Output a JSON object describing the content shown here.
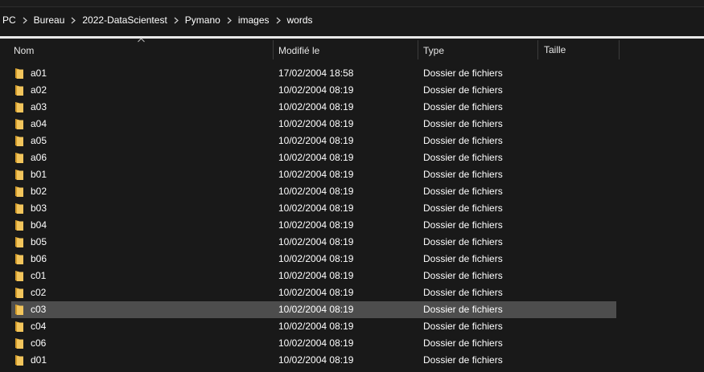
{
  "breadcrumb": [
    "PC",
    "Bureau",
    "2022-DataScientest",
    "Pymano",
    "images",
    "words"
  ],
  "columns": {
    "name": "Nom",
    "modified": "Modifié le",
    "type": "Type",
    "size": "Taille"
  },
  "rows": [
    {
      "name": "a01",
      "modified": "17/02/2004 18:58",
      "type": "Dossier de fichiers",
      "size": ""
    },
    {
      "name": "a02",
      "modified": "10/02/2004 08:19",
      "type": "Dossier de fichiers",
      "size": ""
    },
    {
      "name": "a03",
      "modified": "10/02/2004 08:19",
      "type": "Dossier de fichiers",
      "size": ""
    },
    {
      "name": "a04",
      "modified": "10/02/2004 08:19",
      "type": "Dossier de fichiers",
      "size": ""
    },
    {
      "name": "a05",
      "modified": "10/02/2004 08:19",
      "type": "Dossier de fichiers",
      "size": ""
    },
    {
      "name": "a06",
      "modified": "10/02/2004 08:19",
      "type": "Dossier de fichiers",
      "size": ""
    },
    {
      "name": "b01",
      "modified": "10/02/2004 08:19",
      "type": "Dossier de fichiers",
      "size": ""
    },
    {
      "name": "b02",
      "modified": "10/02/2004 08:19",
      "type": "Dossier de fichiers",
      "size": ""
    },
    {
      "name": "b03",
      "modified": "10/02/2004 08:19",
      "type": "Dossier de fichiers",
      "size": ""
    },
    {
      "name": "b04",
      "modified": "10/02/2004 08:19",
      "type": "Dossier de fichiers",
      "size": ""
    },
    {
      "name": "b05",
      "modified": "10/02/2004 08:19",
      "type": "Dossier de fichiers",
      "size": ""
    },
    {
      "name": "b06",
      "modified": "10/02/2004 08:19",
      "type": "Dossier de fichiers",
      "size": ""
    },
    {
      "name": "c01",
      "modified": "10/02/2004 08:19",
      "type": "Dossier de fichiers",
      "size": ""
    },
    {
      "name": "c02",
      "modified": "10/02/2004 08:19",
      "type": "Dossier de fichiers",
      "size": ""
    },
    {
      "name": "c03",
      "modified": "10/02/2004 08:19",
      "type": "Dossier de fichiers",
      "size": "",
      "selected": true
    },
    {
      "name": "c04",
      "modified": "10/02/2004 08:19",
      "type": "Dossier de fichiers",
      "size": ""
    },
    {
      "name": "c06",
      "modified": "10/02/2004 08:19",
      "type": "Dossier de fichiers",
      "size": ""
    },
    {
      "name": "d01",
      "modified": "10/02/2004 08:19",
      "type": "Dossier de fichiers",
      "size": ""
    }
  ],
  "icons": {
    "folder": "folder-icon",
    "chevron": "chevron-right-icon",
    "sort": "sort-ascending-icon"
  },
  "colors": {
    "background": "#191919",
    "selection": "#4d4d4d",
    "folder": "#f2c55c",
    "divider": "#e8e8e8"
  }
}
